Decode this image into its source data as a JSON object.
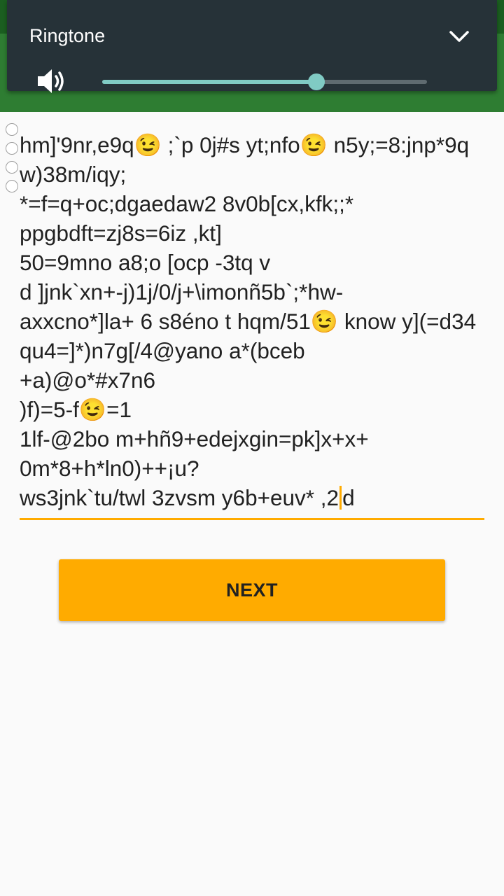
{
  "volume_panel": {
    "title": "Ringtone",
    "volume_level": 0.66,
    "accent_color": "#80cbc4",
    "icons": {
      "expand": "chevron-down-icon",
      "speaker": "speaker-icon"
    }
  },
  "editor": {
    "text_before_cursor": "hm]'9nr,e9q😉 ;`p 0j#s yt;nfo😉 n5y;=8:jnp*9qw)38m/iqy;\n*=f=q+oc;dgaedaw2 8v0b[cx,kfk;;*\nppgbdft=zj8s=6iz ,kt]\n50=9mno a8;o [ocp -3tq v\nd ]jnk`xn+-j)1j/0/j+\\imonñ5b`;*hw-\naxxcno*]la+ 6 s8éno t hqm/51😉 know y](=d34qu4=]*)n7g[/4@yano a*(bceb\n+a)@o*#x7n6\n)f)=5-f😉=1\n1lf-@2bo m+hñ9+edejxgin=pk]x+x+\n0m*8+h*ln0)++¡u?\nws3jnk`tu/twl 3zvsm y6b+euv* ,2",
    "text_after_cursor": "d",
    "underline_color": "#ffab00"
  },
  "actions": {
    "next_label": "NEXT",
    "next_color": "#ffab00"
  }
}
